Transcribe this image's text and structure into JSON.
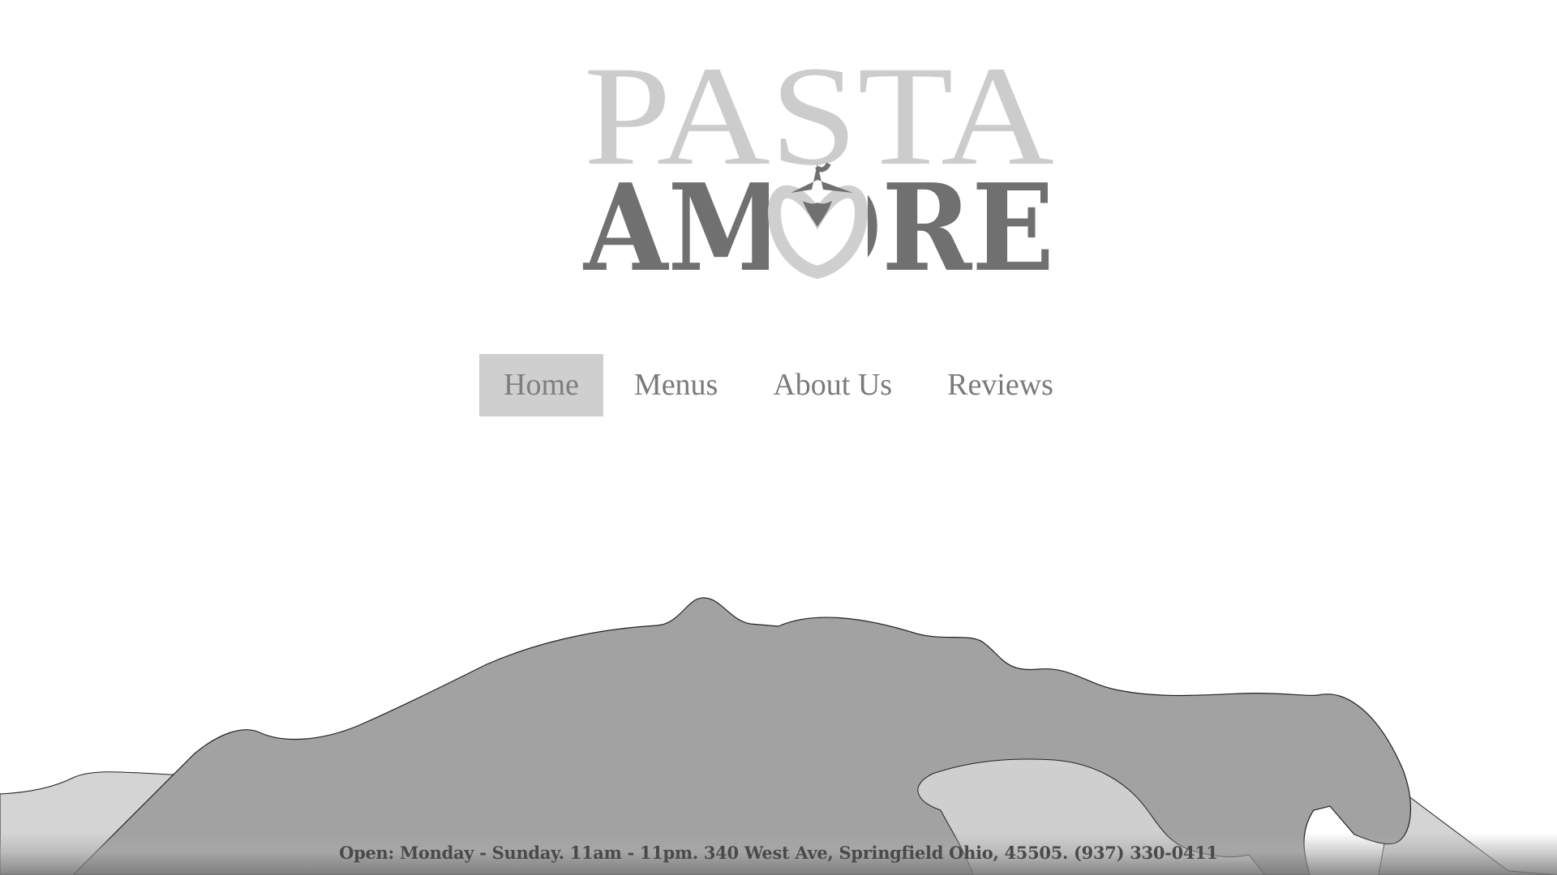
{
  "logo": {
    "line1": "PASTA",
    "line2": "AMORE",
    "colors": {
      "line1": "#cccccc",
      "line2": "#707070",
      "heart": "#cfcfcf",
      "star": "#707070"
    }
  },
  "nav": {
    "items": [
      {
        "label": "Home",
        "active": true
      },
      {
        "label": "Menus",
        "active": false
      },
      {
        "label": "About Us",
        "active": false
      },
      {
        "label": "Reviews",
        "active": false
      }
    ]
  },
  "footer": {
    "text": "Open: Monday - Sunday. 11am - 11pm. 340 West Ave, Springfield Ohio, 45505. (937) 330-0411"
  },
  "colors": {
    "mountain_dark": "#a2a2a2",
    "mountain_light": "#d4d4d4",
    "nav_active_bg": "#cfcfcf",
    "nav_text": "#7a7a7a"
  }
}
